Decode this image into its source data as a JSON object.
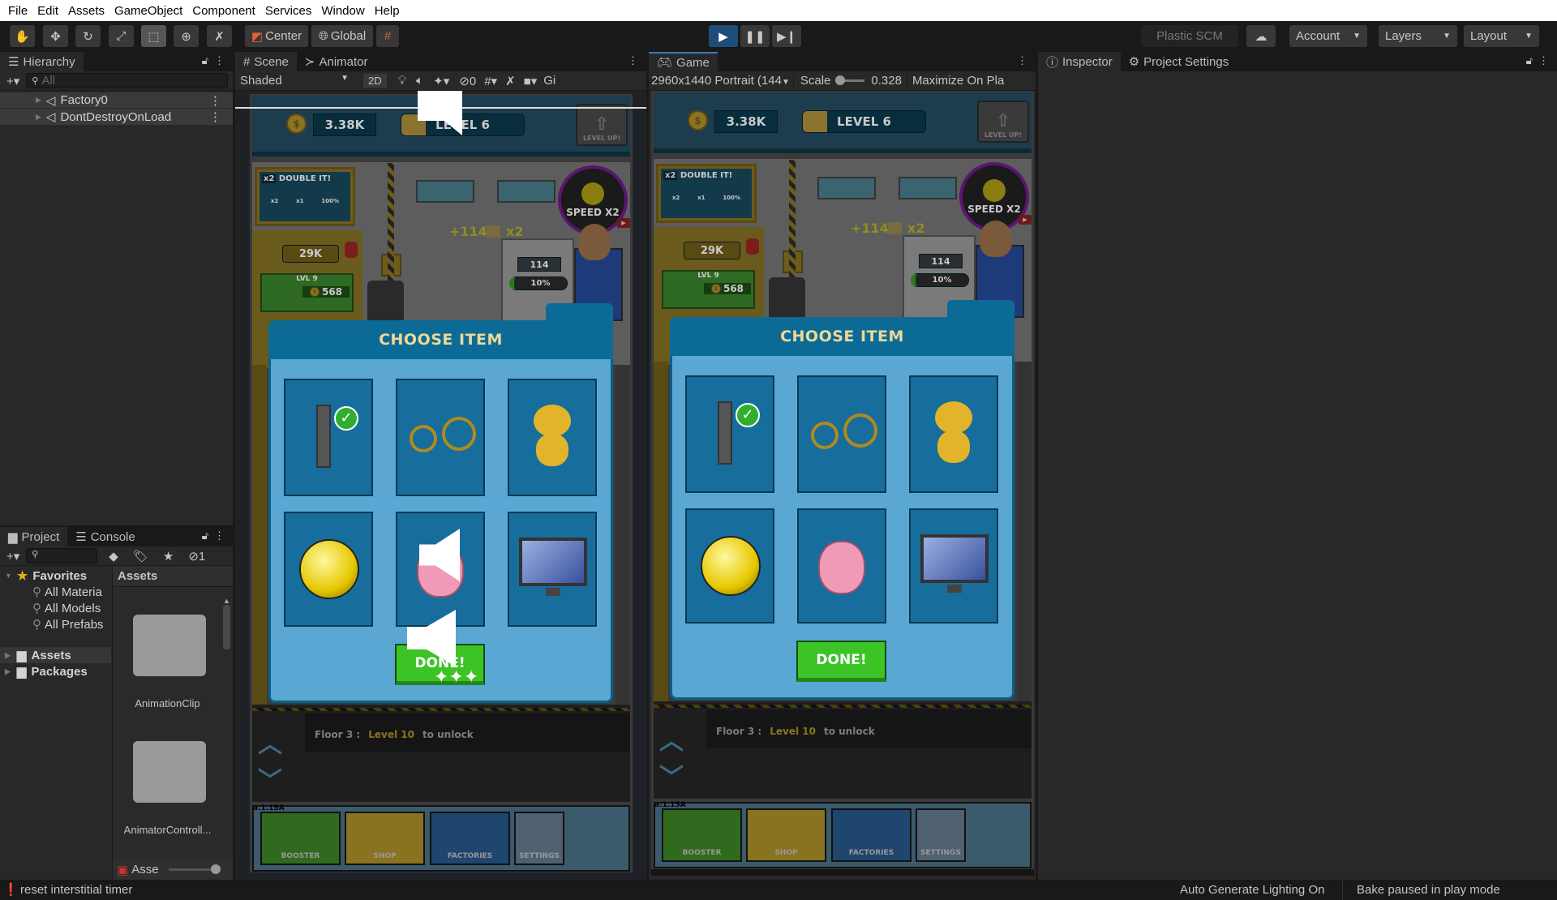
{
  "menu": [
    "File",
    "Edit",
    "Assets",
    "GameObject",
    "Component",
    "Services",
    "Window",
    "Help"
  ],
  "toolbar": {
    "tools": [
      "hand-tool",
      "move-tool",
      "rotate-tool",
      "scale-tool",
      "rect-tool",
      "transform-tool",
      "custom-tool"
    ],
    "pivot": "Center",
    "space": "Global",
    "plastic": "Plastic SCM",
    "account": "Account",
    "layers": "Layers",
    "layout": "Layout",
    "accent": "#1f4d7a"
  },
  "hierarchy": {
    "title": "Hierarchy",
    "search_placeholder": "All",
    "items": [
      "Factory0",
      "DontDestroyOnLoad"
    ]
  },
  "project": {
    "tab_project": "Project",
    "tab_console": "Console",
    "hidden_count": "1",
    "favorites": "Favorites",
    "fav_items": [
      "All Materia",
      "All Models",
      "All Prefabs"
    ],
    "roots": [
      "Assets",
      "Packages"
    ],
    "assets_header": "Assets",
    "folders": [
      "AnimationClip",
      "AnimatorControll..."
    ],
    "footer_label": "Asse"
  },
  "scene": {
    "tab_scene": "Scene",
    "tab_animator": "Animator",
    "shading": "Shaded",
    "mode_2d": "2D",
    "hidden_count": "0",
    "gizmos": "Gi"
  },
  "game": {
    "tab": "Game",
    "resolution": "2960x1440 Portrait (144",
    "scale_label": "Scale",
    "scale_value": "0.328",
    "maximize": "Maximize On Pla"
  },
  "inspector": {
    "tab_inspector": "Inspector",
    "tab_settings": "Project Settings"
  },
  "game_view": {
    "money": "3.38K",
    "level": "LEVEL 6",
    "level_progress": 0.2,
    "level_up": "LEVEL UP!",
    "double_it": "DOUBLE IT!",
    "x2": "x2",
    "boost_labels": [
      "x2",
      "x1",
      "100%"
    ],
    "speed": "SPEED X2",
    "income": "+114",
    "income_mult": "x2",
    "storage": "29K",
    "lvl": "LVL 9",
    "upgrade_cost": "568",
    "truck_load": "114",
    "truck_progress": "10%",
    "dialog_title": "CHOOSE ITEM",
    "items": [
      "battery",
      "bicycle",
      "teddy-bear",
      "bowling-ball",
      "pig",
      "monitor"
    ],
    "selected_item": 0,
    "done": "DONE!",
    "floor_label": "Floor 3 :",
    "floor_level": "Level 10",
    "floor_unlock": "to unlock",
    "version": "a.1.15A",
    "nav": [
      "BOOSTER",
      "SHOP",
      "FACTORIES",
      "SETTINGS"
    ]
  },
  "status": {
    "message": "reset interstitial timer",
    "lighting": "Auto Generate Lighting On",
    "bake": "Bake paused in play mode"
  }
}
